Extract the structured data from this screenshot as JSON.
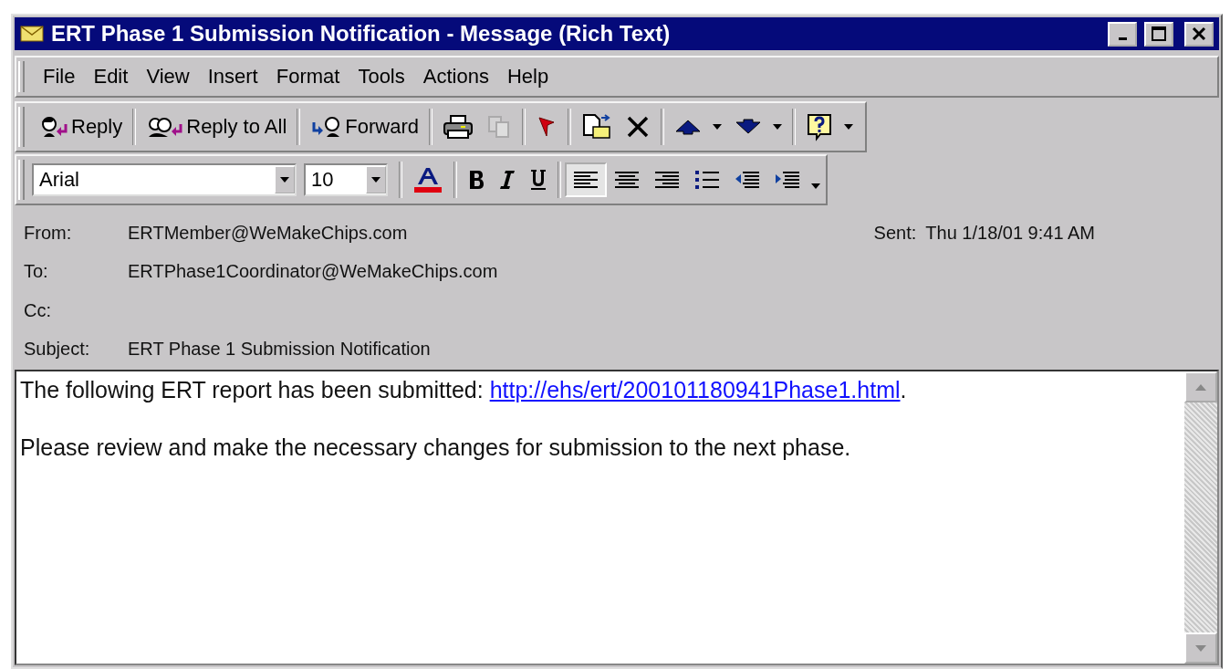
{
  "window": {
    "title": "ERT Phase 1 Submission Notification - Message (Rich Text)"
  },
  "menu": [
    "File",
    "Edit",
    "View",
    "Insert",
    "Format",
    "Tools",
    "Actions",
    "Help"
  ],
  "toolbar": [
    [
      {
        "kind": "reply",
        "label": "Reply",
        "disabled": false,
        "dropdown": false
      }
    ],
    [
      {
        "kind": "reply_all",
        "label": "Reply to All",
        "disabled": false,
        "dropdown": false
      }
    ],
    [
      {
        "kind": "forward",
        "label": "Forward",
        "disabled": false,
        "dropdown": false
      }
    ],
    [
      {
        "kind": "print",
        "disabled": false,
        "dropdown": false
      },
      {
        "kind": "copy",
        "disabled": true,
        "dropdown": false
      }
    ],
    [
      {
        "kind": "flag",
        "disabled": false,
        "dropdown": false
      }
    ],
    [
      {
        "kind": "move",
        "disabled": false,
        "dropdown": false
      },
      {
        "kind": "delete",
        "disabled": false,
        "dropdown": false
      }
    ],
    [
      {
        "kind": "up",
        "disabled": false,
        "dropdown": true
      },
      {
        "kind": "down",
        "disabled": false,
        "dropdown": true
      }
    ],
    [
      {
        "kind": "help",
        "disabled": false,
        "dropdown": true
      }
    ]
  ],
  "format_bar": {
    "font": "Arial",
    "size": "10",
    "groups": [
      [
        {
          "kind": "font_color",
          "selected": false
        }
      ],
      [
        {
          "kind": "bold",
          "selected": false
        },
        {
          "kind": "italic",
          "selected": false
        },
        {
          "kind": "underline",
          "selected": false
        }
      ],
      [
        {
          "kind": "align_left",
          "selected": true
        },
        {
          "kind": "align_center",
          "selected": false
        },
        {
          "kind": "align_right",
          "selected": false
        },
        {
          "kind": "bullets",
          "selected": false
        },
        {
          "kind": "outdent",
          "selected": false
        },
        {
          "kind": "indent",
          "selected": false
        }
      ]
    ]
  },
  "header": {
    "fields": [
      {
        "label": "From:",
        "value": "ERTMember@WeMakeChips.com"
      },
      {
        "label": "To:",
        "value": "ERTPhase1Coordinator@WeMakeChips.com"
      },
      {
        "label": "Cc:"
      },
      {
        "label": "Subject:",
        "value": "ERT Phase 1 Submission Notification"
      }
    ],
    "sent": {
      "label": "Sent:",
      "value": "Thu 1/18/01 9:41 AM"
    }
  },
  "body": {
    "paragraphs": [
      {
        "text": "The following ERT report has been submitted: ",
        "link": "http://ehs/ert/200101180941Phase1.html",
        "after": "."
      },
      {
        "text": "Please review and make the necessary changes for submission to the next phase."
      }
    ]
  }
}
